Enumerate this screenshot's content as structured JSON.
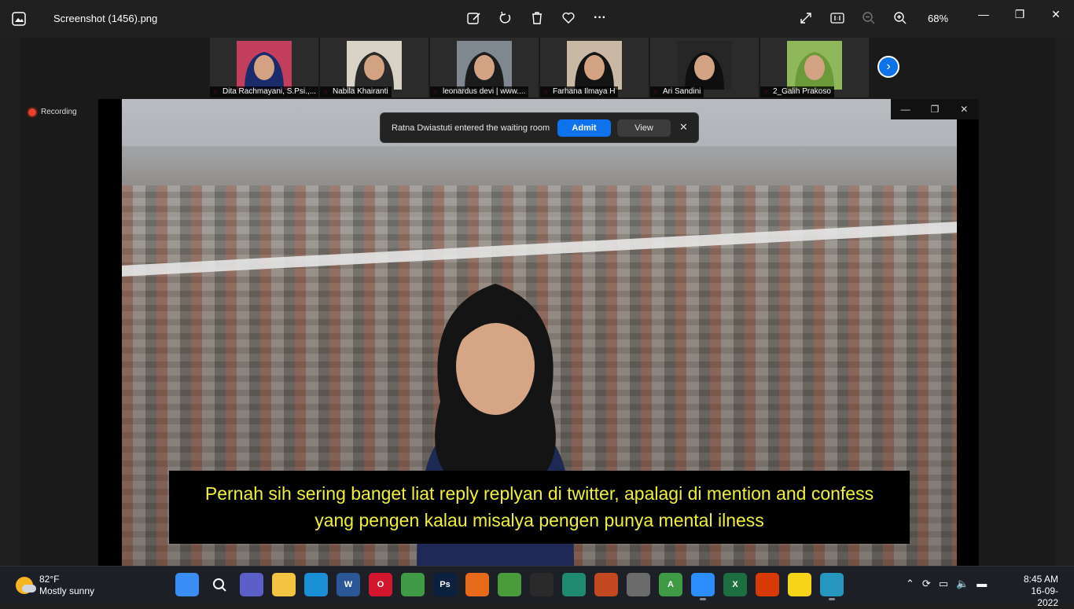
{
  "window": {
    "title": "Screenshot (1456).png",
    "zoom": "68%",
    "controls": {
      "minimize": "—",
      "restore": "❐",
      "close": "✕"
    }
  },
  "toolbar": {
    "icons": [
      "edit-image-icon",
      "rotate-icon",
      "delete-icon",
      "favorite-icon",
      "more-icon"
    ],
    "more_label": "···",
    "right_icons": [
      "fullscreen-icon",
      "actual-size-icon",
      "zoom-out-icon",
      "zoom-in-icon"
    ]
  },
  "participants": [
    {
      "name": "Dita Rachmayani, S.Psi.,...",
      "bg": "#c43f5e",
      "hijab": "#1b2a6b"
    },
    {
      "name": "Nabila Khairanti",
      "bg": "#d9d3c7",
      "hijab": "#2a2a2a"
    },
    {
      "name": "leonardus devi | www....",
      "bg": "#7f8790",
      "hijab": "#1c1c1c"
    },
    {
      "name": "Farhana Ilmaya H",
      "bg": "#c9b9a4",
      "hijab": "#141414"
    },
    {
      "name": "Ari Sandini",
      "bg": "#262626",
      "hijab": "#0f0f0f"
    },
    {
      "name": "2_Galih Prakoso",
      "bg": "#8fb85a",
      "hijab": "#6a9a3a"
    }
  ],
  "recording_label": "Recording",
  "notification": {
    "message": "Ratna Dwiastuti entered the waiting room",
    "admit": "Admit",
    "view": "View",
    "close": "✕"
  },
  "video_controls": {
    "minimize": "—",
    "restore": "❐",
    "close": "✕"
  },
  "caption": {
    "line1": "Pernah sih sering banget liat reply replyan di twitter, apalagi di mention and confess",
    "line2": "yang pengen kalau misalya pengen punya mental ilness"
  },
  "taskbar": {
    "weather": {
      "temp": "82°F",
      "condition": "Mostly sunny"
    },
    "apps": [
      {
        "name": "start-icon",
        "color": "#3a8df5",
        "label": ""
      },
      {
        "name": "search-icon",
        "color": "#1c1f26",
        "label": ""
      },
      {
        "name": "meet-icon",
        "color": "#5b5fc7",
        "label": ""
      },
      {
        "name": "file-explorer-icon",
        "color": "#f5c342",
        "label": ""
      },
      {
        "name": "edge-icon",
        "color": "#1a8fd6",
        "label": ""
      },
      {
        "name": "word-icon",
        "color": "#2b5797",
        "label": "W"
      },
      {
        "name": "opera-icon",
        "color": "#d3162d",
        "label": "O"
      },
      {
        "name": "chrome-icon",
        "color": "#3f9a45",
        "label": ""
      },
      {
        "name": "photoshop-icon",
        "color": "#0b2040",
        "label": "Ps"
      },
      {
        "name": "firefox-icon",
        "color": "#e66a17",
        "label": ""
      },
      {
        "name": "greenshot-icon",
        "color": "#4a9c3a",
        "label": ""
      },
      {
        "name": "obs-icon",
        "color": "#2a2a2a",
        "label": ""
      },
      {
        "name": "app-icon",
        "color": "#1f8a70",
        "label": ""
      },
      {
        "name": "chrome-profile-icon",
        "color": "#c2481f",
        "label": ""
      },
      {
        "name": "tools-icon",
        "color": "#6b6b6b",
        "label": ""
      },
      {
        "name": "chrome-a-icon",
        "color": "#3f9a45",
        "label": "A"
      },
      {
        "name": "zoom-app-icon",
        "color": "#2d8cff",
        "label": ""
      },
      {
        "name": "excel-icon",
        "color": "#1d6f42",
        "label": "X"
      },
      {
        "name": "office-icon",
        "color": "#d83b01",
        "label": ""
      },
      {
        "name": "sticky-notes-icon",
        "color": "#f7d417",
        "label": ""
      },
      {
        "name": "photos-icon",
        "color": "#2596be",
        "label": ""
      }
    ],
    "tray_icons": [
      "chevron-up-icon",
      "sync-icon",
      "display-icon",
      "volume-icon",
      "battery-icon"
    ],
    "tray_glyphs": [
      "⌃",
      "⟳",
      "▭",
      "🔈",
      "▬"
    ],
    "time": "8:45 AM",
    "date": "16-09-2022"
  }
}
